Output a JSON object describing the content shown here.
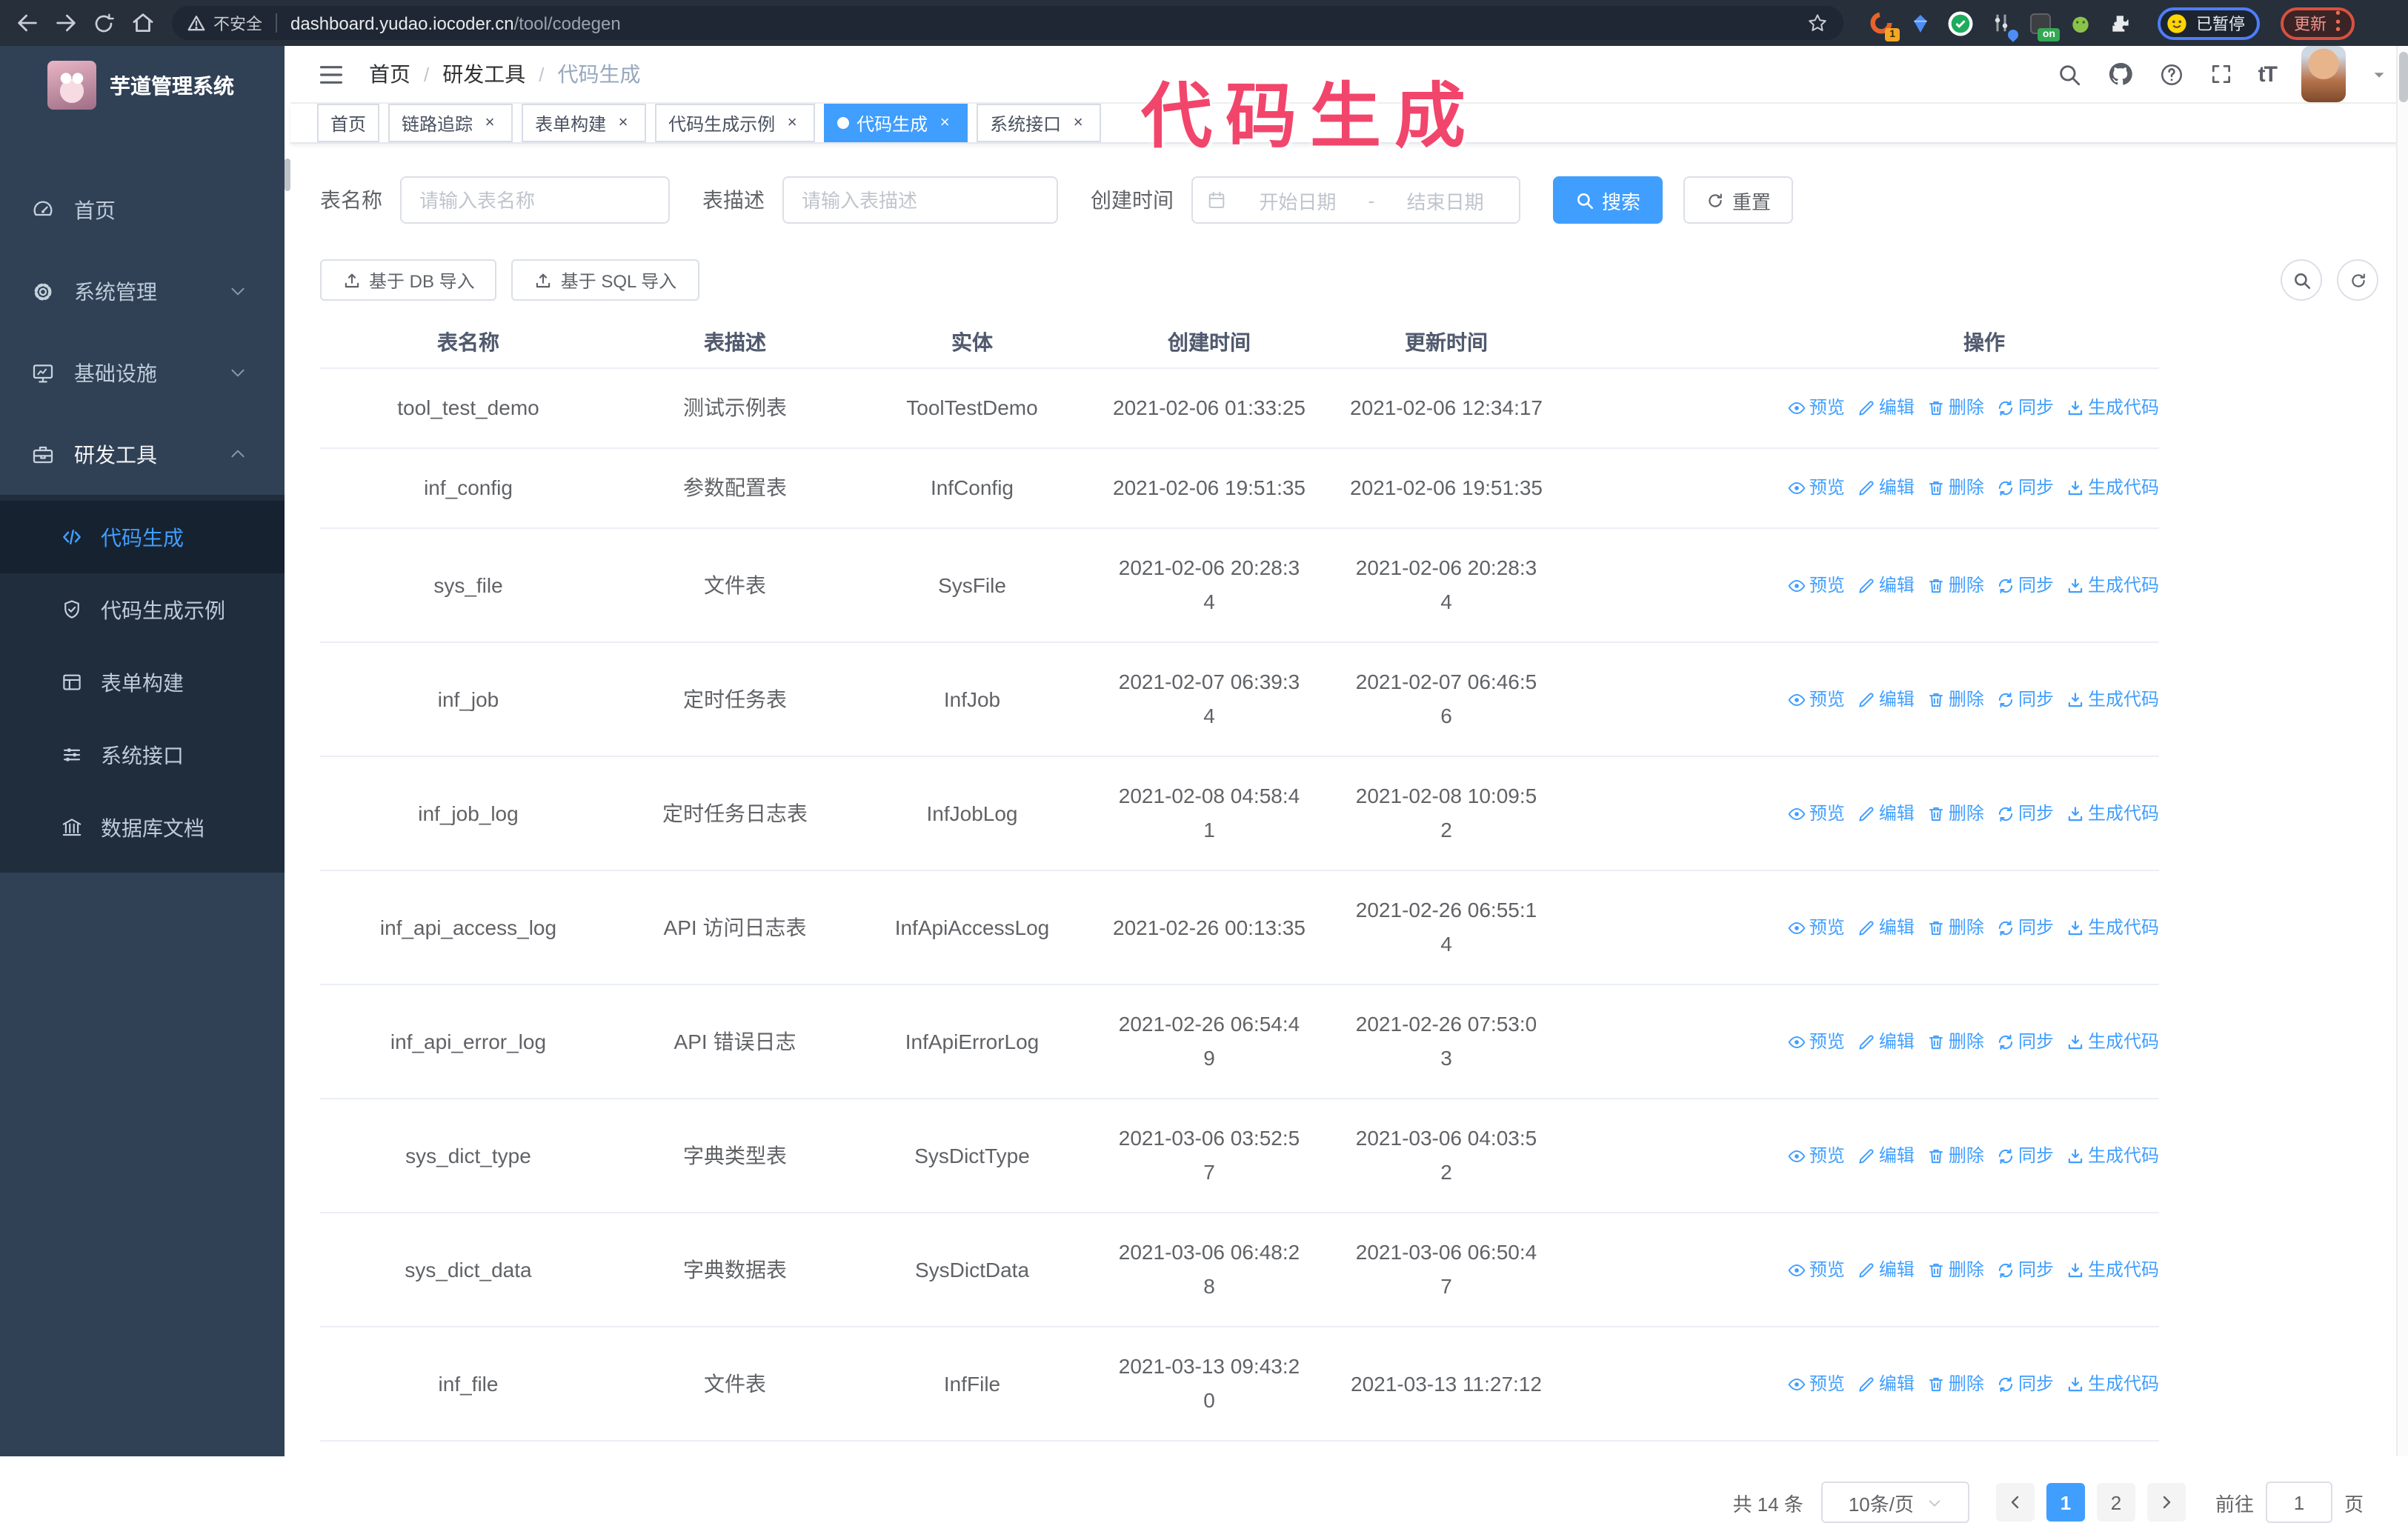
{
  "browser": {
    "security_label": "不安全",
    "url_host": "dashboard.yudao.iocoder.cn",
    "url_path": "/tool/codegen",
    "ext_badge_1": "1",
    "ext_badge_on": "on",
    "paused_badge": "已暂停",
    "update_button": "更新"
  },
  "overlay_title": "代码生成",
  "sidebar": {
    "title": "芋道管理系统",
    "items": [
      {
        "label": "首页",
        "icon": "dashboard-icon",
        "chevron": null,
        "expanded": false
      },
      {
        "label": "系统管理",
        "icon": "gear-icon",
        "chevron": "down",
        "expanded": false
      },
      {
        "label": "基础设施",
        "icon": "monitor-icon",
        "chevron": "down",
        "expanded": false
      },
      {
        "label": "研发工具",
        "icon": "toolbox-icon",
        "chevron": "up",
        "expanded": true
      }
    ],
    "submenu": [
      {
        "label": "代码生成",
        "icon": "code-icon",
        "active": true
      },
      {
        "label": "代码生成示例",
        "icon": "shield-check-icon",
        "active": false
      },
      {
        "label": "表单构建",
        "icon": "form-icon",
        "active": false
      },
      {
        "label": "系统接口",
        "icon": "sliders-icon",
        "active": false
      },
      {
        "label": "数据库文档",
        "icon": "db-doc-icon",
        "active": false
      }
    ]
  },
  "navbar": {
    "breadcrumb": [
      "首页",
      "研发工具",
      "代码生成"
    ],
    "breadcrumb_separator": "/",
    "font_size_label": "tT"
  },
  "tabs": [
    {
      "label": "首页",
      "closable": false,
      "active": false
    },
    {
      "label": "链路追踪",
      "closable": true,
      "active": false
    },
    {
      "label": "表单构建",
      "closable": true,
      "active": false
    },
    {
      "label": "代码生成示例",
      "closable": true,
      "active": false
    },
    {
      "label": "代码生成",
      "closable": true,
      "active": true
    },
    {
      "label": "系统接口",
      "closable": true,
      "active": false
    }
  ],
  "filters": {
    "name_label": "表名称",
    "name_placeholder": "请输入表名称",
    "desc_label": "表描述",
    "desc_placeholder": "请输入表描述",
    "time_label": "创建时间",
    "start_placeholder": "开始日期",
    "range_separator": "-",
    "end_placeholder": "结束日期",
    "search_label": "搜索",
    "reset_label": "重置"
  },
  "toolbar": {
    "db_import_label": "基于 DB 导入",
    "sql_import_label": "基于 SQL 导入"
  },
  "table": {
    "columns": [
      "表名称",
      "表描述",
      "实体",
      "创建时间",
      "更新时间",
      "操作"
    ],
    "actions": [
      {
        "label": "预览",
        "icon": "eye-icon"
      },
      {
        "label": "编辑",
        "icon": "edit-icon"
      },
      {
        "label": "删除",
        "icon": "trash-icon"
      },
      {
        "label": "同步",
        "icon": "sync-icon"
      },
      {
        "label": "生成代码",
        "icon": "download-icon"
      }
    ],
    "rows": [
      {
        "name": "tool_test_demo",
        "desc": "测试示例表",
        "entity": "ToolTestDemo",
        "created": "2021-02-06 01:33:25",
        "updated": "2021-02-06 12:34:17"
      },
      {
        "name": "inf_config",
        "desc": "参数配置表",
        "entity": "InfConfig",
        "created": "2021-02-06 19:51:35",
        "updated": "2021-02-06 19:51:35"
      },
      {
        "name": "sys_file",
        "desc": "文件表",
        "entity": "SysFile",
        "created": "2021-02-06 20:28:3\n4",
        "updated": "2021-02-06 20:28:3\n4"
      },
      {
        "name": "inf_job",
        "desc": "定时任务表",
        "entity": "InfJob",
        "created": "2021-02-07 06:39:3\n4",
        "updated": "2021-02-07 06:46:5\n6"
      },
      {
        "name": "inf_job_log",
        "desc": "定时任务日志表",
        "entity": "InfJobLog",
        "created": "2021-02-08 04:58:4\n1",
        "updated": "2021-02-08 10:09:5\n2"
      },
      {
        "name": "inf_api_access_log",
        "desc": "API 访问日志表",
        "entity": "InfApiAccessLog",
        "created": "2021-02-26 00:13:35",
        "updated": "2021-02-26 06:55:1\n4"
      },
      {
        "name": "inf_api_error_log",
        "desc": "API 错误日志",
        "entity": "InfApiErrorLog",
        "created": "2021-02-26 06:54:4\n9",
        "updated": "2021-02-26 07:53:0\n3"
      },
      {
        "name": "sys_dict_type",
        "desc": "字典类型表",
        "entity": "SysDictType",
        "created": "2021-03-06 03:52:5\n7",
        "updated": "2021-03-06 04:03:5\n2"
      },
      {
        "name": "sys_dict_data",
        "desc": "字典数据表",
        "entity": "SysDictData",
        "created": "2021-03-06 06:48:2\n8",
        "updated": "2021-03-06 06:50:4\n7"
      },
      {
        "name": "inf_file",
        "desc": "文件表",
        "entity": "InfFile",
        "created": "2021-03-13 09:43:2\n0",
        "updated": "2021-03-13 11:27:12"
      }
    ]
  },
  "pagination": {
    "total": "共 14 条",
    "page_size": "10条/页",
    "pages": [
      "1",
      "2"
    ],
    "active_page": "1",
    "jump_prefix": "前往",
    "jump_value": "1",
    "jump_suffix": "页"
  },
  "colors": {
    "accent": "#409eff",
    "overlay_pink": "#f2456b",
    "sidebar_bg": "#304156",
    "submenu_bg": "#1f2d3d",
    "browser_bg": "#262f3a"
  }
}
